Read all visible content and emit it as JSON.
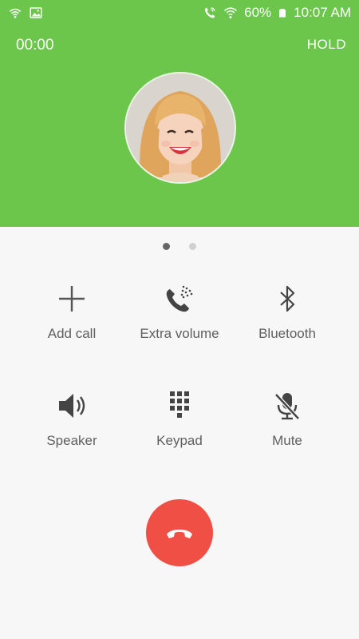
{
  "status_bar": {
    "battery": "60%",
    "time": "10:07 AM",
    "icons": [
      "signal-icon",
      "image-icon",
      "wifi-call-icon",
      "wifi-icon",
      "battery-icon"
    ]
  },
  "call": {
    "timer": "00:00",
    "hold_label": "HOLD",
    "header_color": "#6cc64b",
    "page_count": 2,
    "active_page": 1
  },
  "actions": [
    {
      "label": "Add call",
      "icon": "plus-icon"
    },
    {
      "label": "Extra volume",
      "icon": "phone-volume-icon"
    },
    {
      "label": "Bluetooth",
      "icon": "bluetooth-icon"
    },
    {
      "label": "Speaker",
      "icon": "speaker-icon"
    },
    {
      "label": "Keypad",
      "icon": "keypad-icon"
    },
    {
      "label": "Mute",
      "icon": "mic-off-icon"
    }
  ],
  "end_call": {
    "icon": "phone-hangup-icon",
    "color": "#ef4f45"
  }
}
